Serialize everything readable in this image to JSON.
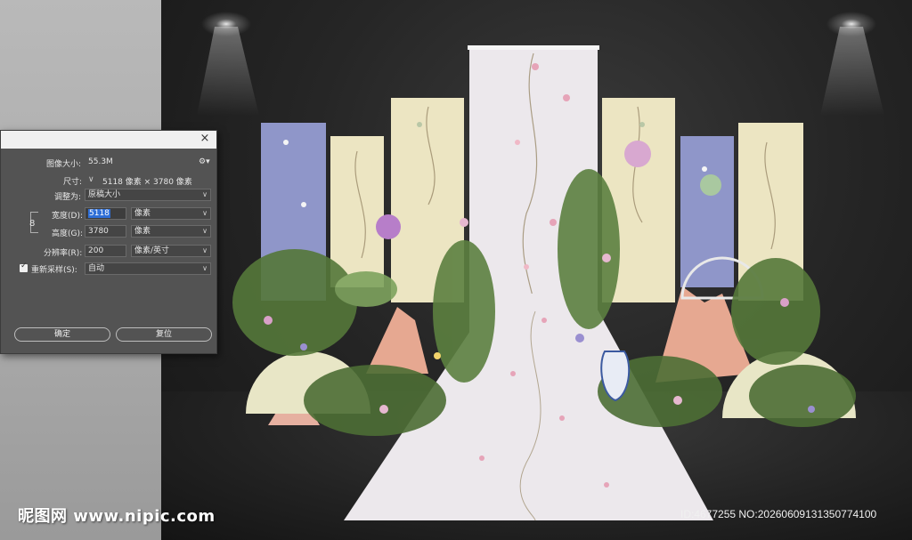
{
  "dialog": {
    "image_size_label": "图像大小:",
    "image_size_value": "55.3M",
    "dimensions_label": "尺寸:",
    "dimensions_value": "5118 像素 × 3780 像素",
    "fit_to_label": "调整为:",
    "fit_to_value": "原稿大小",
    "width_label": "宽度(D):",
    "width_value": "5118",
    "width_unit": "像素",
    "height_label": "高度(G):",
    "height_value": "3780",
    "height_unit": "像素",
    "resolution_label": "分辨率(R):",
    "resolution_value": "200",
    "resolution_unit": "像素/英寸",
    "resample_label": "重新采样(S):",
    "resample_value": "自动",
    "ok_label": "确定",
    "reset_label": "复位",
    "close_symbol": "×"
  },
  "watermark": {
    "logo_text": "昵图网 www.nipic.com",
    "id_text": "ID:4677255 NO:20260609131350774100"
  },
  "colors": {
    "panel_bg": "#535353",
    "highlight": "#2f6fd6",
    "backdrop_purple": "#8f96c9",
    "backdrop_cream": "#ece5c2",
    "runner": "#ece8ec"
  }
}
